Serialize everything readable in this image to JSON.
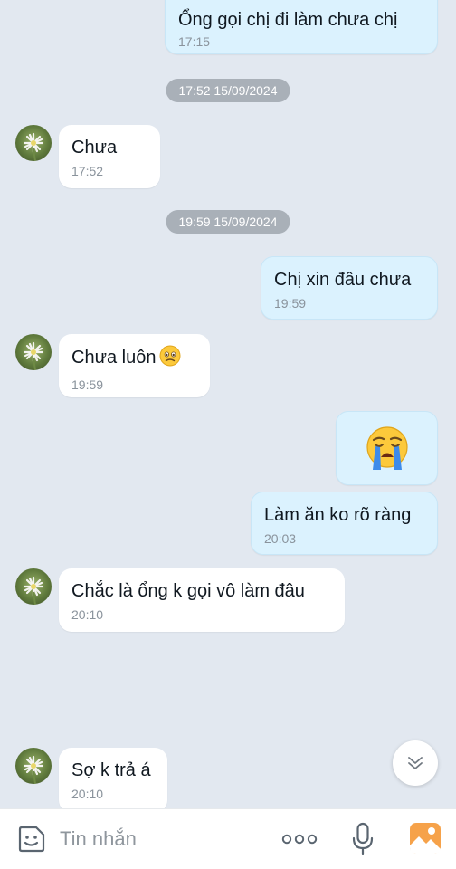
{
  "messages": [
    {
      "text": "Ổng gọi chị đi làm chưa chị",
      "time": "17:15"
    },
    {
      "text": "Chưa",
      "time": "17:52"
    },
    {
      "text": "Chị xin đâu chưa",
      "time": "19:59"
    },
    {
      "text": "Chưa luôn",
      "time": "19:59",
      "emoji": "worried-face"
    },
    {
      "emoji": "loudly-crying-face"
    },
    {
      "text": "Làm ăn ko rõ ràng",
      "time": "20:03"
    },
    {
      "text": "Chắc là ổng k gọi vô làm đâu",
      "time": "20:10"
    },
    {
      "text": "Sợ k trả á",
      "time": "20:10"
    }
  ],
  "dates": [
    {
      "label": "17:52 15/09/2024"
    },
    {
      "label": "19:59 15/09/2024"
    }
  ],
  "input": {
    "placeholder": "Tin nhắn"
  },
  "icons": [
    "sticker-icon",
    "more-icon",
    "microphone-icon",
    "image-icon",
    "chevron-down-icon",
    "avatar"
  ],
  "colors": {
    "background": "#e2e8f0",
    "incoming_bubble": "#ffffff",
    "outgoing_bubble": "#dbf2fe",
    "date_chip": "#a9b0b8",
    "accent": "#1f8ef1"
  }
}
